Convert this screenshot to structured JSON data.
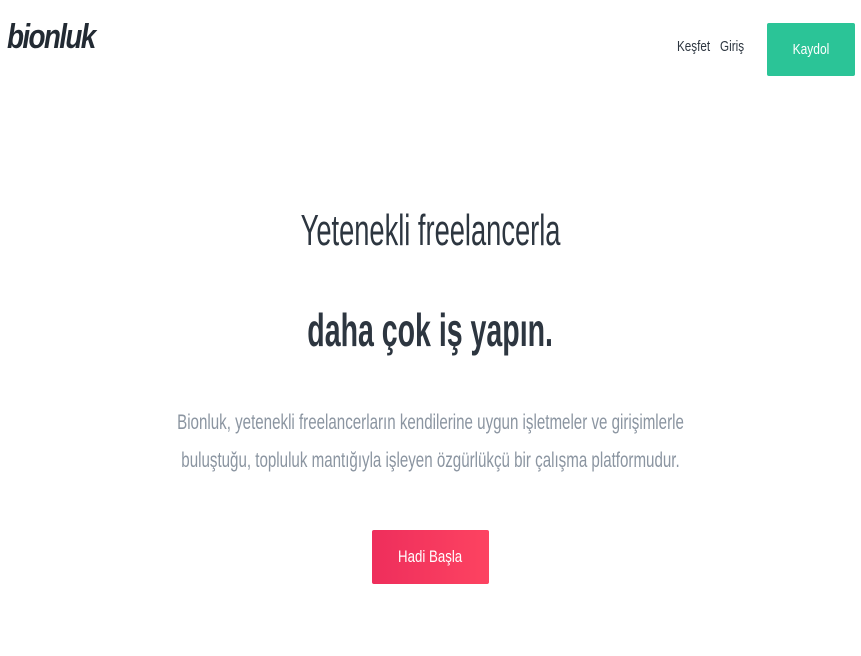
{
  "header": {
    "logo_text": "bionluk",
    "nav": {
      "explore_label": "Keşfet",
      "login_label": "Giriş"
    },
    "signup_label": "Kaydol"
  },
  "hero": {
    "headline_line1": "Yetenekli freelancerla",
    "headline_line2": "daha çok iş yapın.",
    "description_line1": "Bionluk, yetenekli freelancerların kendilerine uygun işletmeler ve girişimlerle",
    "description_line2": "buluştuğu, topluluk mantığıyla işleyen özgürlükçü bir çalışma platformudur.",
    "cta_label": "Hadi Başla"
  },
  "colors": {
    "signup_bg": "#2bc497",
    "cta_gradient_start": "#ee2e5c",
    "cta_gradient_end": "#fd4361",
    "text_dark": "#2d3640",
    "text_muted": "#8b95a1"
  }
}
